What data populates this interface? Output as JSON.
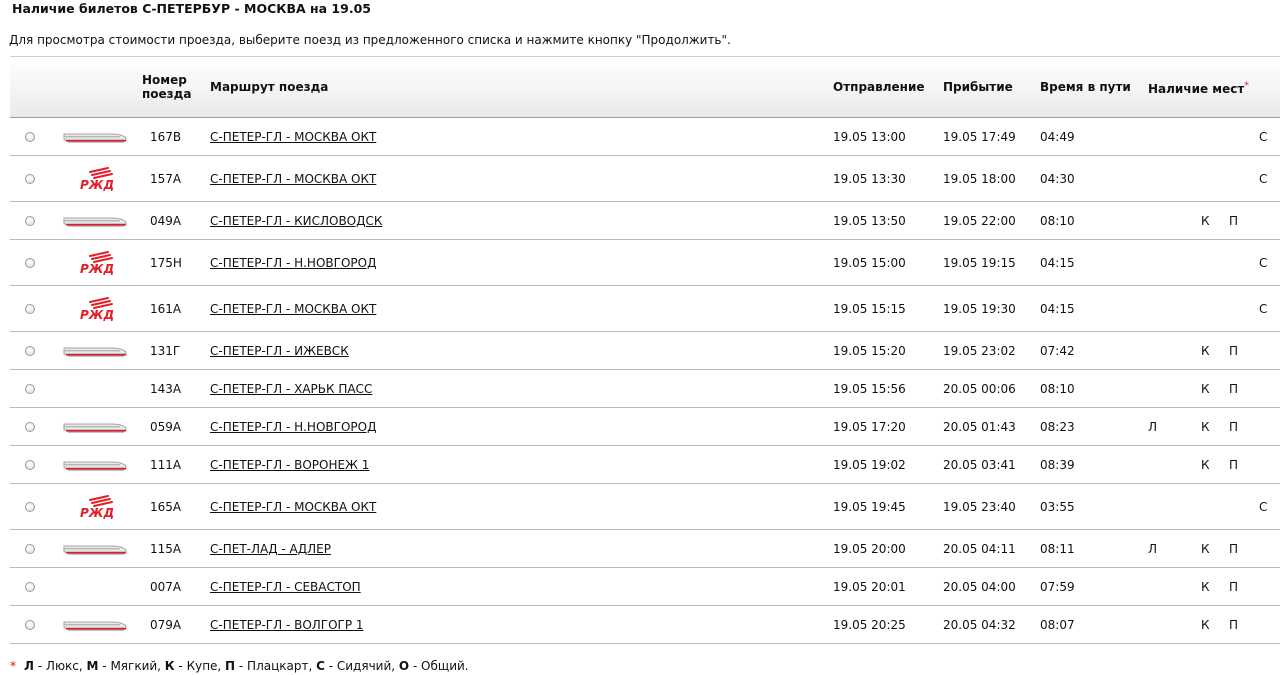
{
  "page": {
    "title": "Наличие билетов С-ПЕТЕРБУР - МОСКВА на 19.05",
    "hint": "Для просмотра стоимости проезда, выберите поезд из предложенного списка и нажмите кнопку \"Продолжить\"."
  },
  "columns": {
    "number_line1": "Номер",
    "number_line2": "поезда",
    "route": "Маршрут поезда",
    "departure": "Отправление",
    "arrival": "Прибытие",
    "duration": "Время в пути",
    "seats": "Наличие мест",
    "seats_mark": "*"
  },
  "trains": [
    {
      "logo": "high-speed-train-icon",
      "number": "167В",
      "route": "С-ПЕТЕР-ГЛ - МОСКВА ОКТ",
      "departure": "19.05 13:00",
      "arrival": "19.05 17:49",
      "duration": "04:49",
      "l": "",
      "k": "",
      "p": "",
      "c": "С"
    },
    {
      "logo": "rzd-logo",
      "number": "157А",
      "route": "С-ПЕТЕР-ГЛ - МОСКВА ОКТ",
      "departure": "19.05 13:30",
      "arrival": "19.05 18:00",
      "duration": "04:30",
      "l": "",
      "k": "",
      "p": "",
      "c": "С"
    },
    {
      "logo": "high-speed-train-icon",
      "number": "049А",
      "route": "С-ПЕТЕР-ГЛ - КИСЛОВОДСК",
      "departure": "19.05 13:50",
      "arrival": "19.05 22:00",
      "duration": "08:10",
      "l": "",
      "k": "К",
      "p": "П",
      "c": ""
    },
    {
      "logo": "rzd-logo",
      "number": "175Н",
      "route": "С-ПЕТЕР-ГЛ - Н.НОВГОРОД",
      "departure": "19.05 15:00",
      "arrival": "19.05 19:15",
      "duration": "04:15",
      "l": "",
      "k": "",
      "p": "",
      "c": "С"
    },
    {
      "logo": "rzd-logo",
      "number": "161А",
      "route": "С-ПЕТЕР-ГЛ - МОСКВА ОКТ",
      "departure": "19.05 15:15",
      "arrival": "19.05 19:30",
      "duration": "04:15",
      "l": "",
      "k": "",
      "p": "",
      "c": "С"
    },
    {
      "logo": "high-speed-train-icon",
      "number": "131Г",
      "route": "С-ПЕТЕР-ГЛ - ИЖЕВСК",
      "departure": "19.05 15:20",
      "arrival": "19.05 23:02",
      "duration": "07:42",
      "l": "",
      "k": "К",
      "p": "П",
      "c": ""
    },
    {
      "logo": "",
      "number": "143А",
      "route": "С-ПЕТЕР-ГЛ - ХАРЬК ПАСС",
      "departure": "19.05 15:56",
      "arrival": "20.05 00:06",
      "duration": "08:10",
      "l": "",
      "k": "К",
      "p": "П",
      "c": ""
    },
    {
      "logo": "high-speed-train-icon",
      "number": "059А",
      "route": "С-ПЕТЕР-ГЛ - Н.НОВГОРОД",
      "departure": "19.05 17:20",
      "arrival": "20.05 01:43",
      "duration": "08:23",
      "l": "Л",
      "k": "К",
      "p": "П",
      "c": ""
    },
    {
      "logo": "high-speed-train-icon",
      "number": "111А",
      "route": "С-ПЕТЕР-ГЛ - ВОРОНЕЖ 1",
      "departure": "19.05 19:02",
      "arrival": "20.05 03:41",
      "duration": "08:39",
      "l": "",
      "k": "К",
      "p": "П",
      "c": ""
    },
    {
      "logo": "rzd-logo",
      "number": "165А",
      "route": "С-ПЕТЕР-ГЛ - МОСКВА ОКТ",
      "departure": "19.05 19:45",
      "arrival": "19.05 23:40",
      "duration": "03:55",
      "l": "",
      "k": "",
      "p": "",
      "c": "С"
    },
    {
      "logo": "high-speed-train-icon",
      "number": "115А",
      "route": "С-ПЕТ-ЛАД - АДЛЕР",
      "departure": "19.05 20:00",
      "arrival": "20.05 04:11",
      "duration": "08:11",
      "l": "Л",
      "k": "К",
      "p": "П",
      "c": ""
    },
    {
      "logo": "",
      "number": "007А",
      "route": "С-ПЕТЕР-ГЛ - СЕВАСТОП",
      "departure": "19.05 20:01",
      "arrival": "20.05 04:00",
      "duration": "07:59",
      "l": "",
      "k": "К",
      "p": "П",
      "c": ""
    },
    {
      "logo": "high-speed-train-icon",
      "number": "079А",
      "route": "С-ПЕТЕР-ГЛ - ВОЛГОГР 1",
      "departure": "19.05 20:25",
      "arrival": "20.05 04:32",
      "duration": "08:07",
      "l": "",
      "k": "К",
      "p": "П",
      "c": ""
    }
  ],
  "legend": {
    "mark": "*",
    "items": [
      {
        "code": "Л",
        "text": " - Люкс, "
      },
      {
        "code": "М",
        "text": " - Мягкий, "
      },
      {
        "code": "К",
        "text": " - Купе, "
      },
      {
        "code": "П",
        "text": " - Плацкарт, "
      },
      {
        "code": "С",
        "text": " - Сидячий, "
      },
      {
        "code": "О",
        "text": " - Общий."
      }
    ]
  },
  "colors": {
    "accent_mark": "#ee0000",
    "rzd_red": "#e41e26"
  }
}
